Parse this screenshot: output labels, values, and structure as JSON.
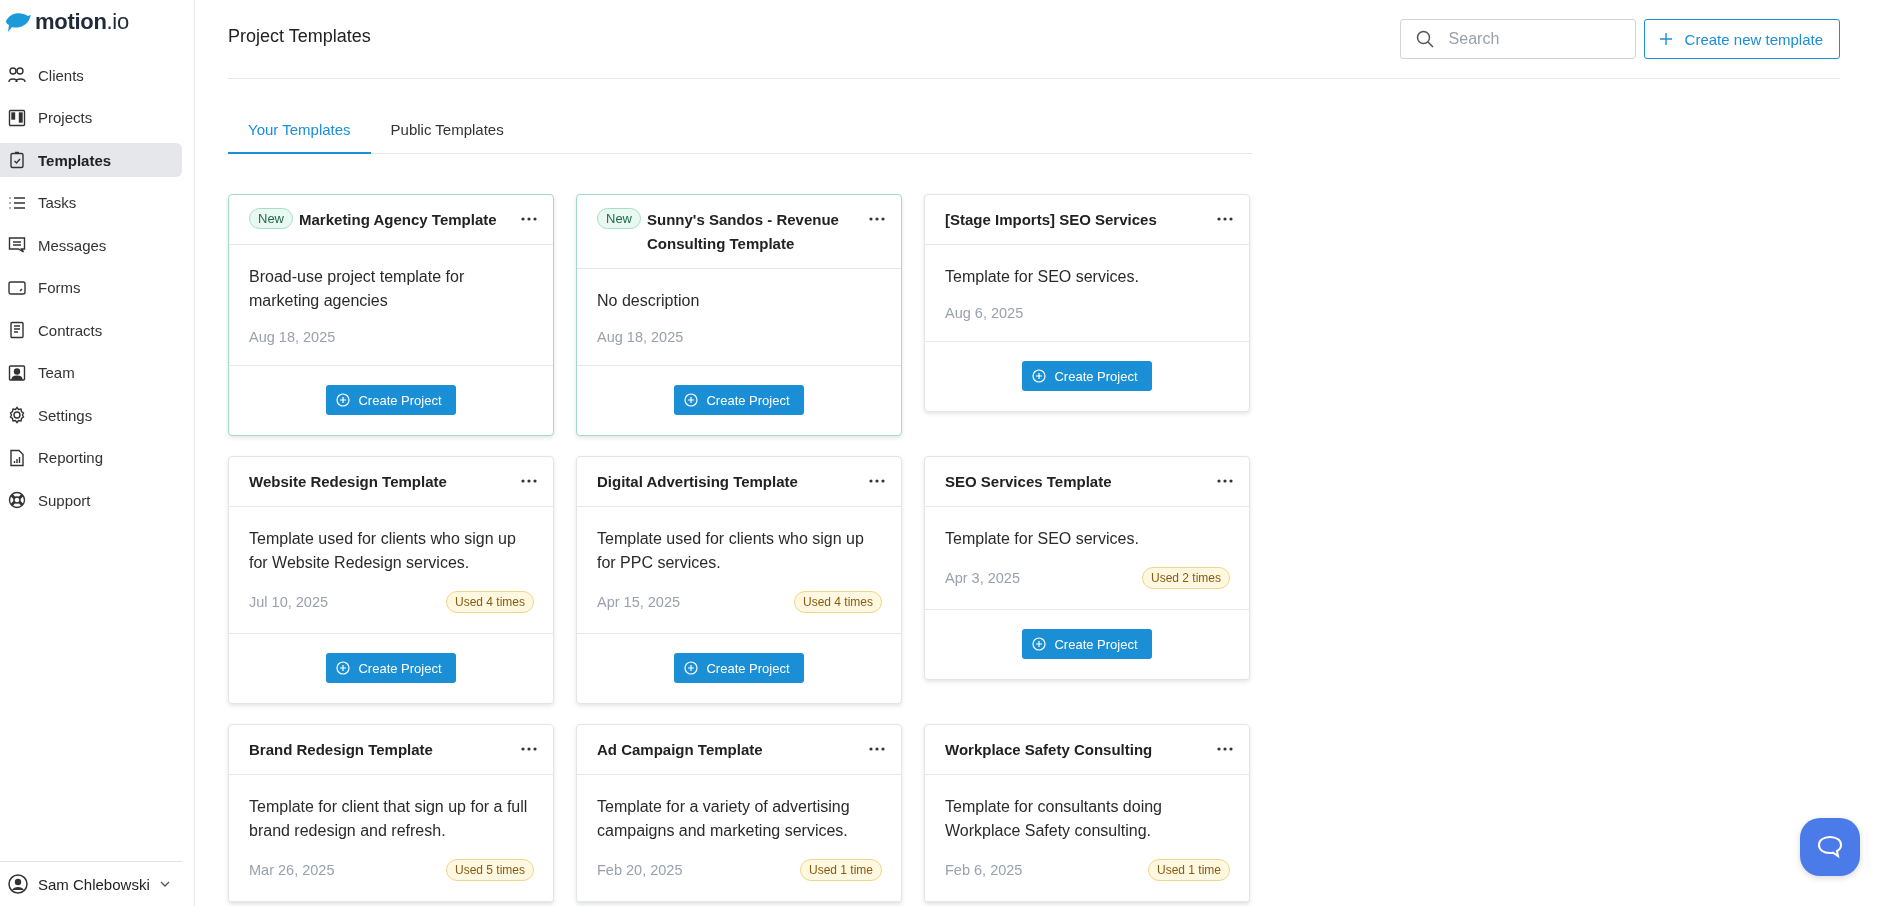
{
  "brand": {
    "name": "motion",
    "suffix": ".io"
  },
  "sidebar": {
    "items": [
      {
        "label": "Clients",
        "selected": false
      },
      {
        "label": "Projects",
        "selected": false
      },
      {
        "label": "Templates",
        "selected": true
      },
      {
        "label": "Tasks",
        "selected": false
      },
      {
        "label": "Messages",
        "selected": false
      },
      {
        "label": "Forms",
        "selected": false
      },
      {
        "label": "Contracts",
        "selected": false
      },
      {
        "label": "Team",
        "selected": false
      },
      {
        "label": "Settings",
        "selected": false
      },
      {
        "label": "Reporting",
        "selected": false
      },
      {
        "label": "Support",
        "selected": false
      }
    ],
    "user": {
      "name": "Sam Chlebowski"
    }
  },
  "header": {
    "title": "Project Templates",
    "search": {
      "placeholder": "Search"
    },
    "create_button": "Create new template"
  },
  "tabs": [
    {
      "label": "Your Templates",
      "selected": true
    },
    {
      "label": "Public Templates",
      "selected": false
    }
  ],
  "templates": [
    {
      "badge": "New",
      "title": "Marketing Agency Template",
      "description": "Broad-use project template for marketing agencies",
      "date": "Aug 18, 2025",
      "button": "Create Project"
    },
    {
      "badge": "New",
      "title": "Sunny's Sandos - Revenue Consulting Template",
      "description": "No description",
      "date": "Aug 18, 2025",
      "button": "Create Project"
    },
    {
      "title": "[Stage Imports] SEO Services",
      "description": "Template for SEO services.",
      "date": "Aug 6, 2025",
      "button": "Create Project"
    },
    {
      "title": "Website Redesign Template",
      "description": "Template used for clients who sign up for Website Redesign services.",
      "date": "Jul 10, 2025",
      "usage": "Used 4 times",
      "button": "Create Project"
    },
    {
      "title": "Digital Advertising Template",
      "description": "Template used for clients who sign up for PPC services.",
      "date": "Apr 15, 2025",
      "usage": "Used 4 times",
      "button": "Create Project"
    },
    {
      "title": "SEO Services Template",
      "description": "Template for SEO services.",
      "date": "Apr 3, 2025",
      "usage": "Used 2 times",
      "button": "Create Project"
    },
    {
      "title": "Brand Redesign Template",
      "description": "Template for client that sign up for a full brand redesign and refresh.",
      "date": "Mar 26, 2025",
      "usage": "Used 5 times"
    },
    {
      "title": "Ad Campaign Template",
      "description": "Template for a variety of advertising campaigns and marketing services.",
      "date": "Feb 20, 2025",
      "usage": "Used 1 time"
    },
    {
      "title": "Workplace Safety Consulting",
      "description": "Template for consultants doing Workplace Safety consulting.",
      "date": "Feb 6, 2025",
      "usage": "Used 1 time"
    }
  ]
}
